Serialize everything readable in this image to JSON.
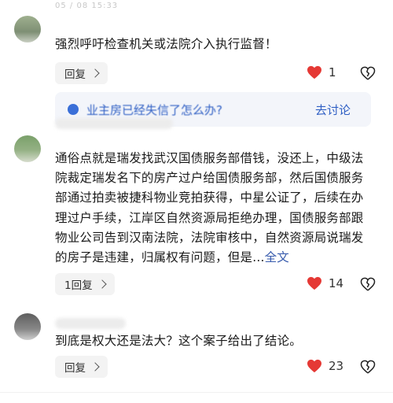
{
  "comments": [
    {
      "text": "强烈呼吁检查机关或法院介入执行监督！",
      "reply_label": "回复",
      "likes": "1",
      "meta_blur": "05 / 08  15:33"
    },
    {
      "text": "通俗点就是瑞发找武汉国债服务部借钱，没还上，中级法院裁定瑞发名下的房产过户给国债服务部，然后国债服务部通过拍卖被捷科物业竞拍获得，中星公证了，后续在办理过户手续，江岸区自然资源局拒绝办理，国债服务部跟物业公司告到汉南法院，法院审核中，自然资源局说瑞发的房子是违建，归属权有问题，但是...",
      "more_label": "全文",
      "reply_label": "1回复",
      "likes": "14"
    },
    {
      "text": "到底是权大还是法大？这个案子给出了结论。",
      "reply_label": "回复",
      "likes": "23"
    }
  ],
  "banner": {
    "text": "业主房已经失信了怎么办?",
    "link_label": "去讨论"
  },
  "colors": {
    "heart_active": "#e53935",
    "link_blue": "#2f5fc4"
  },
  "icons": {
    "like": "heart-icon",
    "dislike": "broken-heart-icon",
    "reply": "chevron-right-icon"
  }
}
